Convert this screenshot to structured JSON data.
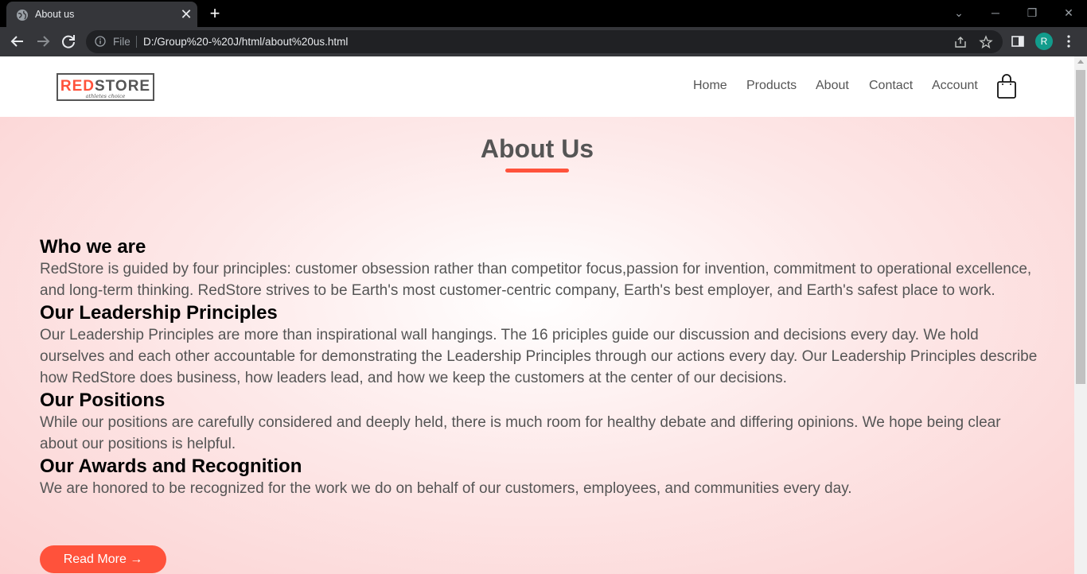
{
  "browser": {
    "tab_title": "About us",
    "new_tab": "+",
    "tab_close": "✕",
    "omnibox_scheme": "File",
    "url": "D:/Group%20-%20J/html/about%20us.html",
    "profile_initial": "R",
    "controls": {
      "dropdown": "⌄",
      "minimize": "─",
      "restore": "❐",
      "close": "✕"
    },
    "icons": {
      "back": "arrow-left-icon",
      "forward": "arrow-right-icon",
      "reload": "reload-icon",
      "share": "share-icon",
      "bookmark": "star-icon",
      "side_panel": "side-panel-icon",
      "menu": "kebab-menu-icon"
    }
  },
  "site": {
    "logo": {
      "red": "RED",
      "rest": "STORE",
      "tagline": "athletes choice"
    },
    "nav": [
      "Home",
      "Products",
      "About",
      "Contact",
      "Account"
    ],
    "cart_icon": "shopping-bag-icon"
  },
  "about": {
    "title": "About Us",
    "sections": [
      {
        "heading": "Who we are",
        "text": "RedStore is guided by four principles: customer obsession rather than competitor focus,passion for invention, commitment to operational excellence, and long-term thinking. RedStore strives to be Earth's most customer-centric company, Earth's best employer, and Earth's safest place to work."
      },
      {
        "heading": "Our Leadership Principles",
        "text": "Our Leadership Principles are more than inspirational wall hangings. The 16 priciples guide our discussion and decisions every day. We hold ourselves and each other accountable for demonstrating the Leadership Principles through our actions every day. Our Leadership Principles describe how RedStore does business, how leaders lead, and how we keep the customers at the center of our decisions."
      },
      {
        "heading": "Our Positions",
        "text": "While our positions are carefully considered and deeply held, there is much room for healthy debate and differing opinions. We hope being clear about our positions is helpful."
      },
      {
        "heading": "Our Awards and Recognition",
        "text": "We are honored to be recognized for the work we do on behalf of our customers, employees, and communities every day."
      }
    ],
    "button": "Read More →"
  },
  "colors": {
    "accent": "#ff523b",
    "text": "#555555",
    "chrome_dark": "#35363a"
  }
}
